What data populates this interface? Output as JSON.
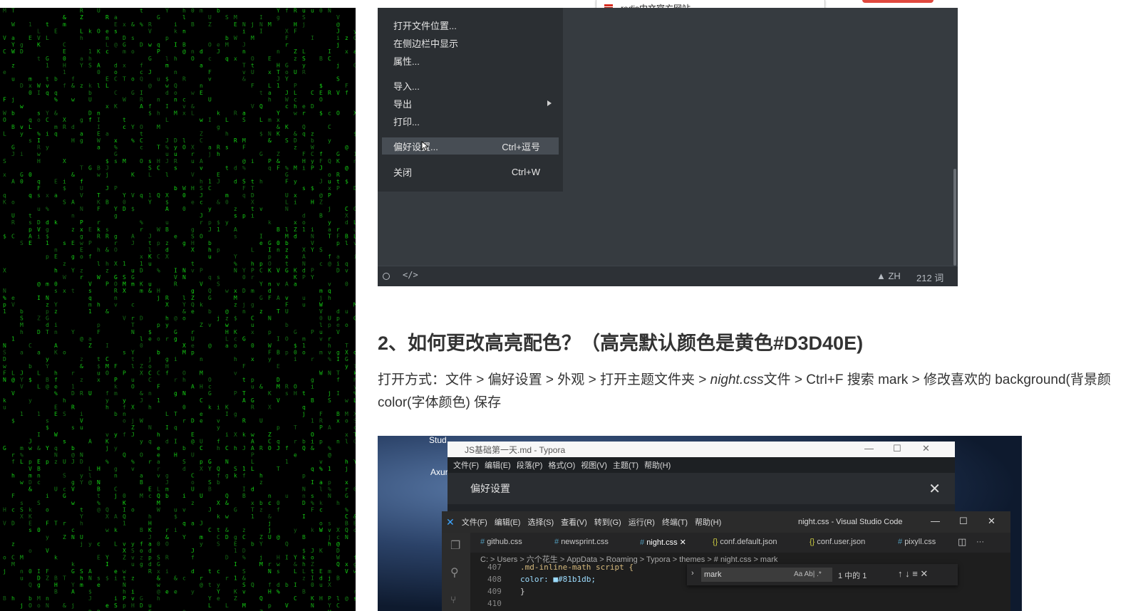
{
  "browser": {
    "tab_title": "redis中文官方网站"
  },
  "typora_menu": {
    "items": [
      {
        "label": "打开文件位置...",
        "shortcut": ""
      },
      {
        "label": "在侧边栏中显示",
        "shortcut": ""
      },
      {
        "label": "属性...",
        "shortcut": ""
      },
      {
        "label": "导入...",
        "shortcut": ""
      },
      {
        "label": "导出",
        "shortcut": ""
      },
      {
        "label": "打印...",
        "shortcut": ""
      },
      {
        "label": "偏好设置...",
        "shortcut": "Ctrl+逗号"
      },
      {
        "label": "关闭",
        "shortcut": "Ctrl+W"
      }
    ],
    "highlighted_item": "偏好设置..."
  },
  "typora_status": {
    "source_icon": "</>",
    "language": "▲ ZH",
    "word_count": "212 词"
  },
  "article": {
    "heading": "2、如何更改高亮配色？（高亮默认颜色是黄色#D3D40E)",
    "para_part1": "打开方式：文件 > 偏好设置 > 外观 > 打开主题文件夹 > ",
    "para_em": "night.css",
    "para_part2": "文件 > Ctrl+F 搜索 mark > 修改喜欢的 background(背景颜",
    "para_line2": "color(字体颜色) 保存"
  },
  "screenshot": {
    "desktop_label_1": "Stud",
    "desktop_label_2": "Axur",
    "typora_title": "JS基础第一天.md - Typora",
    "typora_menubar": [
      "文件(F)",
      "编辑(E)",
      "段落(P)",
      "格式(O)",
      "视图(V)",
      "主题(T)",
      "帮助(H)"
    ],
    "prefs_title": "偏好设置",
    "vscode_menubar": [
      "文件(F)",
      "编辑(E)",
      "选择(S)",
      "查看(V)",
      "转到(G)",
      "运行(R)",
      "终端(T)",
      "帮助(H)"
    ],
    "vscode_title": "night.css - Visual Studio Code",
    "vscode_tabs": [
      "github.css",
      "newsprint.css",
      "night.css",
      "conf.default.json",
      "conf.user.json",
      "pixyll.css"
    ],
    "breadcrumb": "C: > Users > 六个花生 > AppData > Roaming > Typora > themes > # night.css > mark",
    "code_lines": [
      {
        "num": "407",
        "text": ".md-inline-math script {"
      },
      {
        "num": "408",
        "text": "    color: ■#81b1db;"
      },
      {
        "num": "409",
        "text": "}"
      },
      {
        "num": "410",
        "text": ""
      }
    ],
    "find_text": "mark",
    "find_options": "Aa  Ab|  .*",
    "find_result": "1 中的 1",
    "find_nav": "↑  ↓  ≡  ✕"
  },
  "colors": {
    "matrix_green": "#1fa31f",
    "typora_bg": "#363b40",
    "menu_bg": "#2b2f33"
  }
}
